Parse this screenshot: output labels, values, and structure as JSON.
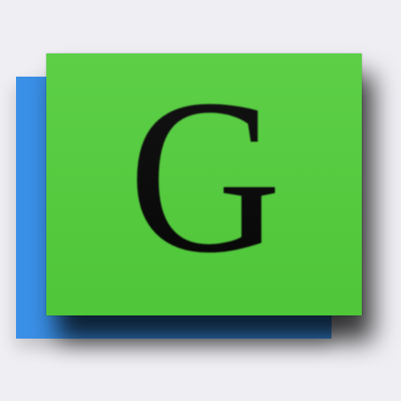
{
  "app_icon": {
    "letter": "G",
    "colors": {
      "background": "#eeeef3",
      "back_tile": "#3a8fe6",
      "front_tile": "#52cc3b",
      "glyph": "#050505"
    }
  }
}
